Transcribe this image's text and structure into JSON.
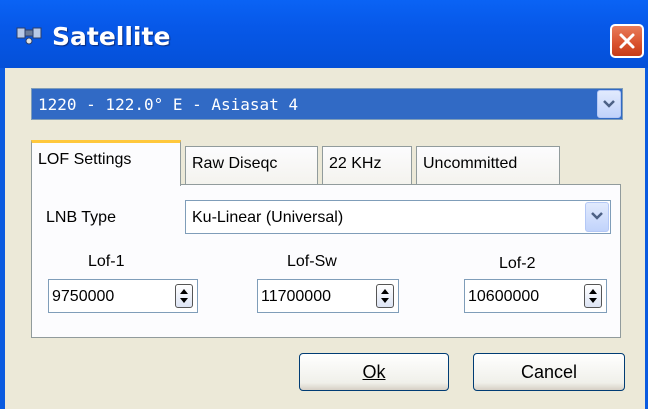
{
  "window": {
    "title": "Satellite"
  },
  "satellite": {
    "selected": "1220 - 122.0° E - Asiasat 4"
  },
  "tabs": [
    {
      "label": "LOF Settings"
    },
    {
      "label": "Raw Diseqc"
    },
    {
      "label": "22 KHz"
    },
    {
      "label": "Uncommitted"
    }
  ],
  "lof": {
    "lnb_type_label": "LNB Type",
    "lnb_type_value": "Ku-Linear (Universal)",
    "lof1_label": "Lof-1",
    "lof1_value": "9750000",
    "lofsw_label": "Lof-Sw",
    "lofsw_value": "11700000",
    "lof2_label": "Lof-2",
    "lof2_value": "10600000"
  },
  "buttons": {
    "ok_label": "Ok",
    "cancel_label": "Cancel"
  },
  "colors": {
    "titlebar": "#0758e8",
    "client": "#ece9d8",
    "selection": "#316ac5",
    "tab_highlight": "#ffc83c"
  }
}
